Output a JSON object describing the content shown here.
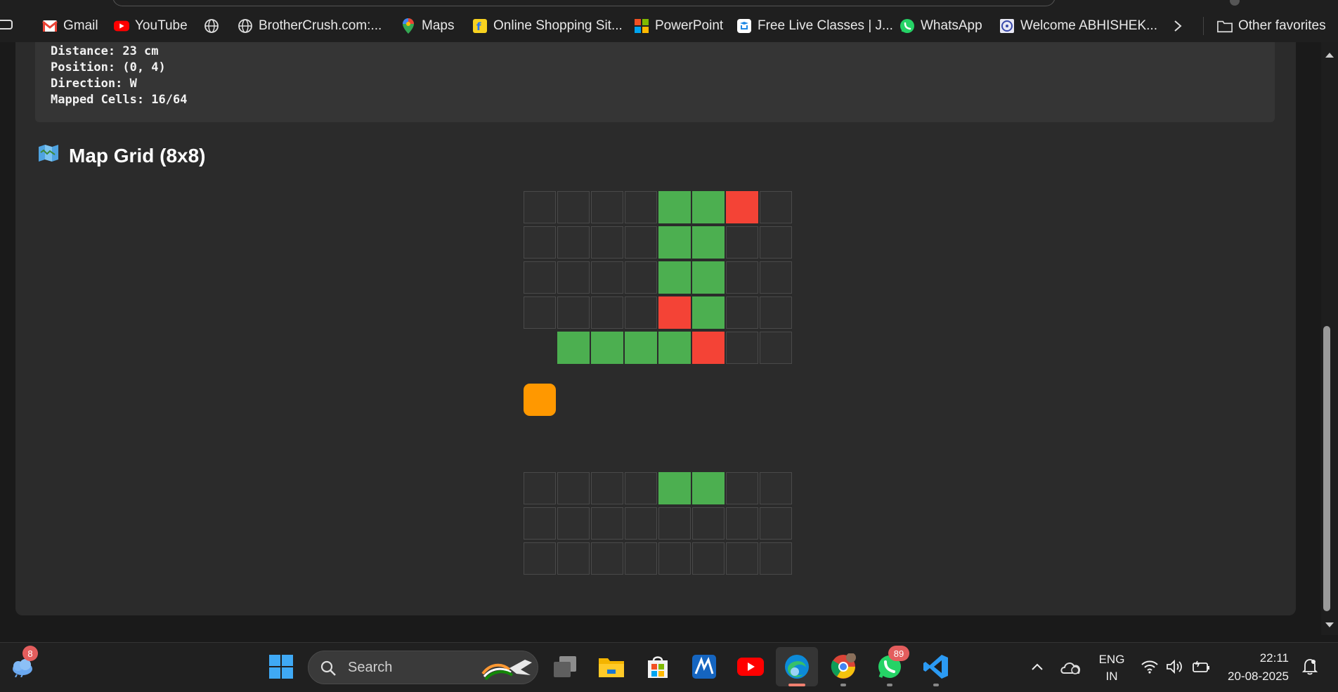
{
  "bookmarks": [
    {
      "label": "Gmail",
      "icon": "gmail-icon"
    },
    {
      "label": "YouTube",
      "icon": "youtube-icon"
    },
    {
      "label": "",
      "icon": "globe-icon"
    },
    {
      "label": "BrotherCrush.com:...",
      "icon": "globe-icon"
    },
    {
      "label": "Maps",
      "icon": "maps-pin-icon"
    },
    {
      "label": "Online Shopping Sit...",
      "icon": "shopping-bag-icon"
    },
    {
      "label": "PowerPoint",
      "icon": "microsoft-logo-icon"
    },
    {
      "label": "Free Live Classes | J...",
      "icon": "classes-icon"
    },
    {
      "label": "WhatsApp",
      "icon": "whatsapp-icon"
    },
    {
      "label": "Welcome ABHISHEK...",
      "icon": "emblem-icon"
    }
  ],
  "other_favorites": "Other favorites",
  "status": {
    "distance": "Distance: 23 cm",
    "position": "Position: (0, 4)",
    "direction": "Direction: W",
    "mapped": "Mapped Cells: 16/64"
  },
  "map": {
    "icon": "map-icon",
    "title": "Map Grid (8x8)",
    "legend": {
      "free": "#4caf50",
      "obstacle": "#f44336",
      "robot": "#ff9800",
      "unknown": "#2f2f2f"
    },
    "rows": [
      [
        "unknown",
        "unknown",
        "unknown",
        "unknown",
        "free",
        "free",
        "obstacle",
        "unknown"
      ],
      [
        "unknown",
        "unknown",
        "unknown",
        "unknown",
        "free",
        "free",
        "unknown",
        "unknown"
      ],
      [
        "unknown",
        "unknown",
        "unknown",
        "unknown",
        "free",
        "free",
        "unknown",
        "unknown"
      ],
      [
        "unknown",
        "unknown",
        "unknown",
        "unknown",
        "obstacle",
        "free",
        "unknown",
        "unknown"
      ],
      [
        "robot",
        "free",
        "free",
        "free",
        "free",
        "obstacle",
        "unknown",
        "unknown"
      ],
      [
        "unknown",
        "unknown",
        "unknown",
        "unknown",
        "free",
        "free",
        "unknown",
        "unknown"
      ],
      [
        "unknown",
        "unknown",
        "unknown",
        "unknown",
        "unknown",
        "unknown",
        "unknown",
        "unknown"
      ],
      [
        "unknown",
        "unknown",
        "unknown",
        "unknown",
        "unknown",
        "unknown",
        "unknown",
        "unknown"
      ]
    ]
  },
  "taskbar": {
    "weather_badge": "8",
    "search_placeholder": "Search",
    "whatsapp_badge": "89",
    "lang_line1": "ENG",
    "lang_line2": "IN",
    "time": "22:11",
    "date": "20-08-2025"
  }
}
